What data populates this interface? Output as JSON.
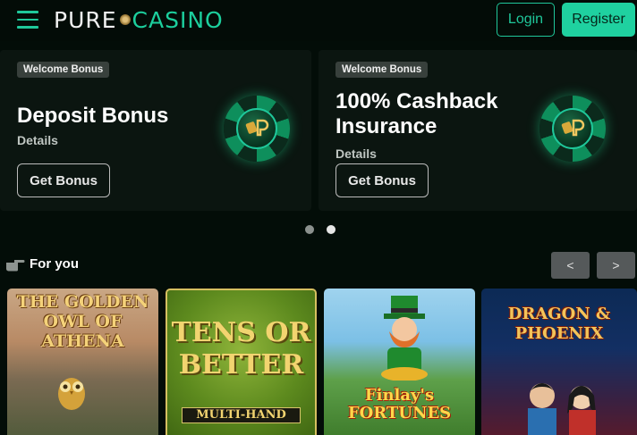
{
  "header": {
    "logo_part1": "PURE",
    "logo_part2": "CASINO",
    "login_label": "Login",
    "register_label": "Register"
  },
  "banners": [
    {
      "badge": "Welcome Bonus",
      "title": "Deposit Bonus",
      "details": "Details",
      "button": "Get Bonus"
    },
    {
      "badge": "Welcome Bonus",
      "title": "100% Cashback Insurance",
      "details": "Details",
      "button": "Get Bonus"
    }
  ],
  "carousel": {
    "dots": 2,
    "active_index": 1
  },
  "for_you": {
    "label": "For you",
    "prev_label": "<",
    "next_label": ">"
  },
  "games": [
    {
      "title": "THE GOLDEN OWL OF ATHENA"
    },
    {
      "title": "TENS OR BETTER",
      "subtitle": "MULTI-HAND"
    },
    {
      "title": "Finlay's FORTUNES"
    },
    {
      "title": "DRAGON & PHOENIX"
    }
  ],
  "colors": {
    "accent": "#1fd1a0",
    "background": "#030d08",
    "banner_bg": "#0b1510"
  }
}
